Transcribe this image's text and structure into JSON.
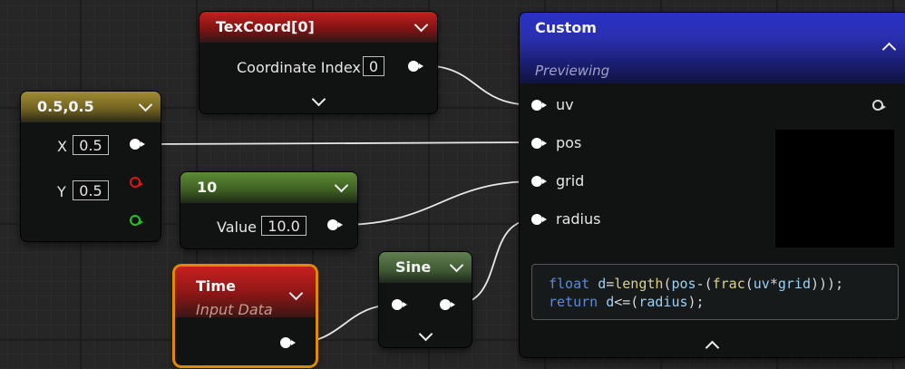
{
  "colors": {
    "param_header": "#8a7a2a",
    "texcoord_header": "#b01c1c",
    "const_header": "#4f7a2e",
    "time_header": "#b51a1a",
    "sine_header": "#4d6b3f",
    "custom_header": "#2f33b8",
    "selected_outline": "#e08a00",
    "wire": "#e8e8e8"
  },
  "texcoord": {
    "title": "TexCoord[0]",
    "input_label": "Coordinate Index",
    "input_value": "0",
    "chevron": "chevron-down-icon"
  },
  "param": {
    "title": "0.5,0.5",
    "x_label": "X",
    "x_value": "0.5",
    "y_label": "Y",
    "y_value": "0.5"
  },
  "constant": {
    "title": "10",
    "value_label": "Value",
    "value": "10.0"
  },
  "time": {
    "title": "Time",
    "subtitle": "Input Data"
  },
  "sine": {
    "title": "Sine"
  },
  "custom": {
    "title": "Custom",
    "status": "Previewing",
    "inputs": [
      "uv",
      "pos",
      "grid",
      "radius"
    ],
    "code": {
      "line1_parts": [
        "float ",
        "d",
        "=",
        "length",
        "(",
        "pos",
        "-(",
        "frac",
        "(",
        "uv",
        "*",
        "grid",
        ")));"
      ],
      "line2_parts": [
        "return ",
        "d",
        "<=(",
        "radius",
        ");"
      ]
    }
  }
}
